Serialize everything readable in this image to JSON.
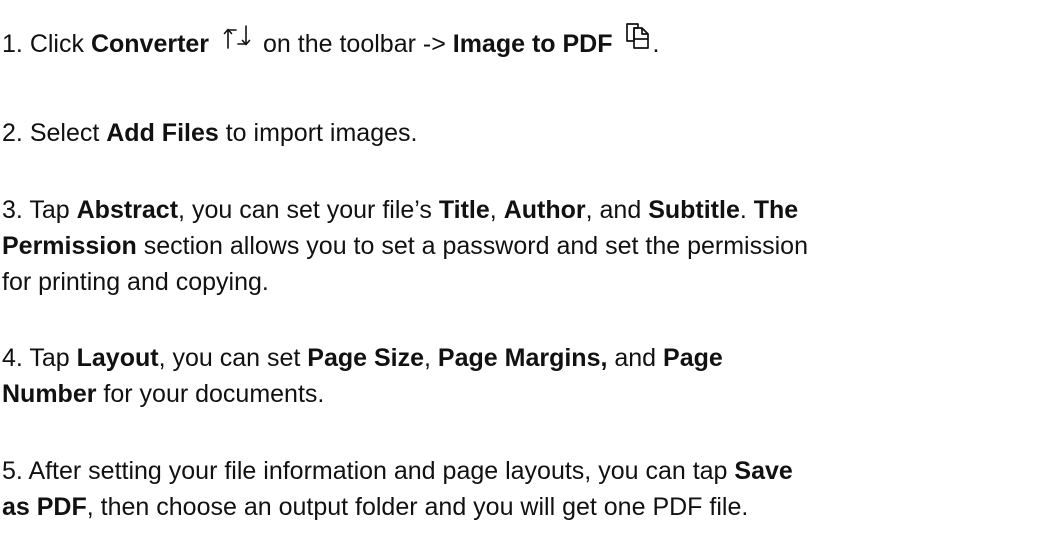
{
  "steps": [
    {
      "n": "1.",
      "t1": "Click",
      "b1": "Converter",
      "t2": "on the toolbar ->",
      "b2": "Image to PDF",
      "t3": ".",
      "icon1": "converter-icon",
      "icon2": "image-to-pdf-icon"
    },
    {
      "n": "2.",
      "t1": "Select",
      "b1": "Add Files",
      "t2": "to import images."
    },
    {
      "n": "3.",
      "t1": "Tap",
      "b1": "Abstract",
      "t2": ", you can set your file’s",
      "b2": "Title",
      "t3": ",",
      "b3": "Author",
      "t4": ", and",
      "b4": "Subtitle",
      "t5": ".",
      "b5": "The",
      "b6": "Permission",
      "t6": "section allows you to set a password and set the permission",
      "t7": "for printing and copying."
    },
    {
      "n": "4.",
      "t1": "Tap",
      "b1": "Layout",
      "t2": ", you can set",
      "b2": "Page Size",
      "t3": ",",
      "b3": "Page Margins,",
      "t4": "and",
      "b4": "Page",
      "b5": "Number",
      "t5": "for your documents."
    },
    {
      "n": "5.",
      "t1": "After setting your file information and page layouts, you can tap",
      "b1": "Save",
      "b2": "as PDF",
      "t2": ", then choose an output folder and you will get one PDF file."
    }
  ]
}
